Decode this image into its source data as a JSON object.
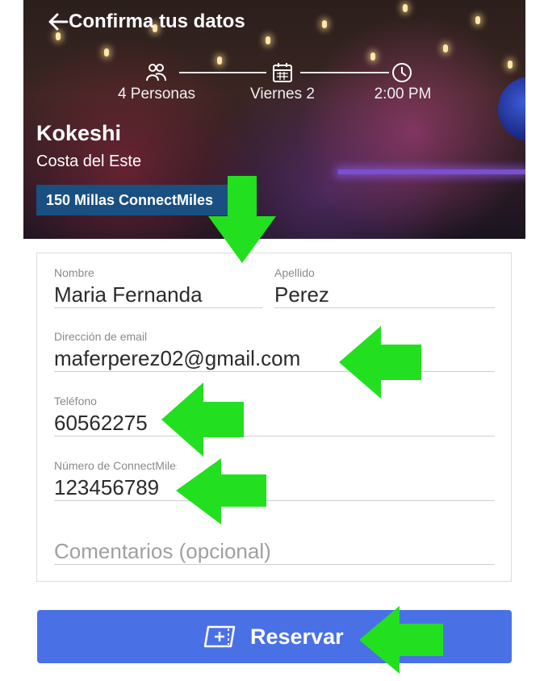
{
  "header": {
    "title": "Confirma tus datos"
  },
  "booking": {
    "people": "4 Personas",
    "date": "Viernes 2",
    "time": "2:00 PM"
  },
  "venue": {
    "name": "Kokeshi",
    "area": "Costa del Este",
    "miles_badge": "150 Millas ConnectMiles"
  },
  "form": {
    "first_name": {
      "label": "Nombre",
      "value": "Maria Fernanda"
    },
    "last_name": {
      "label": "Apellido",
      "value": "Perez"
    },
    "email": {
      "label": "Dirección de email",
      "value": "maferperez02@gmail.com"
    },
    "phone": {
      "label": "Teléfono",
      "value": "60562275"
    },
    "connectmiles": {
      "label": "Número de ConnectMiles",
      "value": "123456789"
    },
    "comments": {
      "placeholder": "Comentarios (opcional)"
    }
  },
  "actions": {
    "reserve_label": "Reservar"
  },
  "colors": {
    "button": "#4a70e6",
    "badge": "#1a4f82",
    "arrow": "#22e01f"
  },
  "icons": [
    "back-arrow-icon",
    "people-icon",
    "calendar-icon",
    "clock-icon",
    "ticket-add-icon"
  ]
}
